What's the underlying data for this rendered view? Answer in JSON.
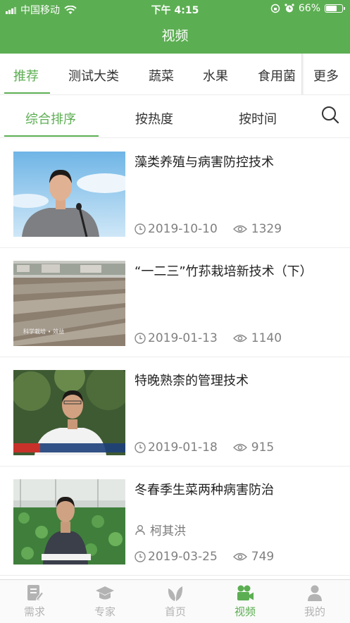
{
  "status_bar": {
    "carrier": "中国移动",
    "time": "下午 4:15",
    "battery": "66%",
    "battery_level": 0.66
  },
  "header": {
    "title": "视频"
  },
  "categories": {
    "items": [
      "推荐",
      "测试大类",
      "蔬菜",
      "水果",
      "食用菌"
    ],
    "active_index": 0,
    "more_label": "更多"
  },
  "sort": {
    "items": [
      "综合排序",
      "按热度",
      "按时间"
    ],
    "active_index": 0,
    "search_icon": "search-icon"
  },
  "videos": [
    {
      "title": "藻类养殖与病害防控技术",
      "author": "",
      "date": "2019-10-10",
      "views": "1329"
    },
    {
      "title": "“一二三”竹荪栽培新技术（下）",
      "author": "",
      "date": "2019-01-13",
      "views": "1140"
    },
    {
      "title": "特晚熟柰的管理技术",
      "author": "",
      "date": "2019-01-18",
      "views": "915"
    },
    {
      "title": "冬春季生菜两种病害防治",
      "author": "柯其洪",
      "date": "2019-03-25",
      "views": "749"
    }
  ],
  "tabbar": {
    "items": [
      {
        "label": "需求",
        "icon": "document-edit-icon"
      },
      {
        "label": "专家",
        "icon": "graduation-cap-icon"
      },
      {
        "label": "首页",
        "icon": "leaf-icon"
      },
      {
        "label": "视频",
        "icon": "video-camera-icon"
      },
      {
        "label": "我的",
        "icon": "user-icon"
      }
    ],
    "active_index": 3
  },
  "colors": {
    "accent": "#5cae52",
    "inactive": "#b3b3b3",
    "text": "#222222",
    "meta": "#808080"
  }
}
